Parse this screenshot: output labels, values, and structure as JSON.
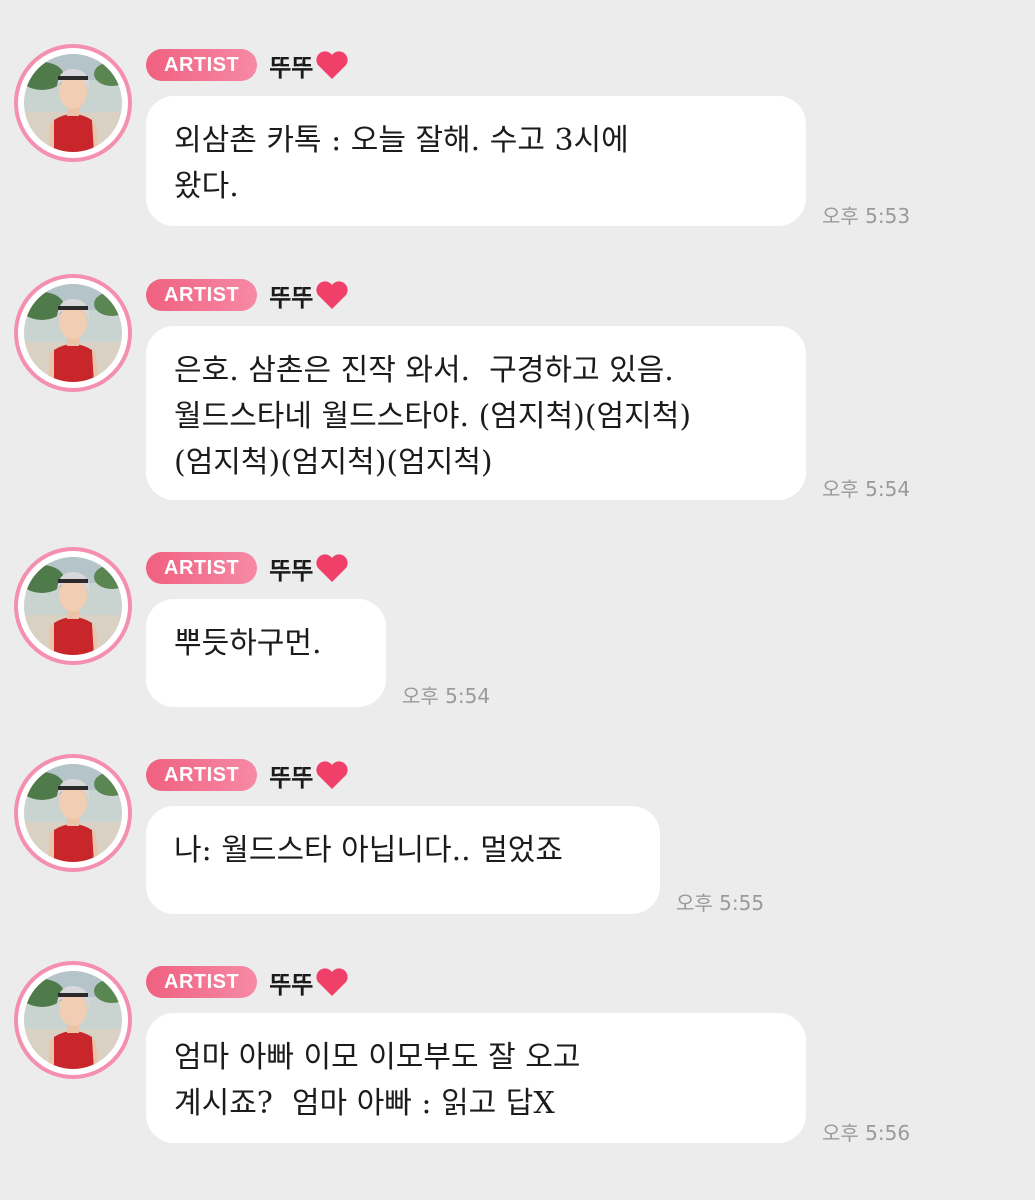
{
  "messages": [
    {
      "badge": "ARTIST",
      "author": "뚜뚜",
      "text": "외삼촌 카톡 : 오늘 잘해. 수고 3시에\n왔다.",
      "time": "오후 5:53"
    },
    {
      "badge": "ARTIST",
      "author": "뚜뚜",
      "text": "은호. 삼촌은 진작 와서.  구경하고 있음.\n월드스타네 월드스타야. (엄지척)(엄지척)\n(엄지척)(엄지척)(엄지척)",
      "time": "오후 5:54"
    },
    {
      "badge": "ARTIST",
      "author": "뚜뚜",
      "text": "뿌듯하구먼.",
      "time": "오후 5:54"
    },
    {
      "badge": "ARTIST",
      "author": "뚜뚜",
      "text": "나: 월드스타 아닙니다.. 멀었죠",
      "time": "오후 5:55"
    },
    {
      "badge": "ARTIST",
      "author": "뚜뚜",
      "text": "엄마 아빠 이모 이모부도 잘 오고\n계시죠?  엄마 아빠 : 읽고 답X",
      "time": "오후 5:56"
    }
  ],
  "icons": {
    "heart": "heart-icon",
    "avatar": "artist-avatar"
  },
  "colors": {
    "background": "#ececec",
    "bubble": "#ffffff",
    "badge": "#f0607f",
    "avatar_ring": "#f58fb0",
    "heart": "#f0406a",
    "time": "#9a9a9a"
  }
}
